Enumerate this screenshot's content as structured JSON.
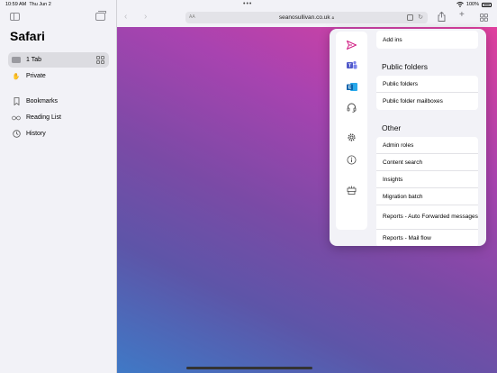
{
  "status": {
    "time": "10:59 AM",
    "date": "Thu Jun 2",
    "battery": "100%"
  },
  "sidebar": {
    "title": "Safari",
    "items": [
      {
        "label": "1 Tab",
        "icon": "tabs-icon",
        "selected": true
      },
      {
        "label": "Private",
        "icon": "hand-icon"
      },
      {
        "label": "Bookmarks",
        "icon": "bookmark-icon"
      },
      {
        "label": "Reading List",
        "icon": "glasses-icon"
      },
      {
        "label": "History",
        "icon": "clock-icon"
      }
    ]
  },
  "toolbar": {
    "aa": "AA",
    "url": "seanosullivan.co.uk"
  },
  "popover": {
    "rail": [
      "send-icon",
      "teams-icon",
      "exchange-icon",
      "headset-icon",
      "gear-icon",
      "info-icon",
      "feedback-icon"
    ],
    "add_ins": "Add ins",
    "public_folders": {
      "title": "Public folders",
      "items": [
        "Public folders",
        "Public folder mailboxes"
      ]
    },
    "other": {
      "title": "Other",
      "items": [
        "Admin roles",
        "Content search",
        "Insights",
        "Migration batch",
        "Reports - Auto Forwarded messages",
        "Reports - Mail flow"
      ]
    }
  },
  "colors": {
    "accent": "#e0409e",
    "gradient_bottom": "#3f79c6",
    "rail_send": "#d11f84"
  }
}
